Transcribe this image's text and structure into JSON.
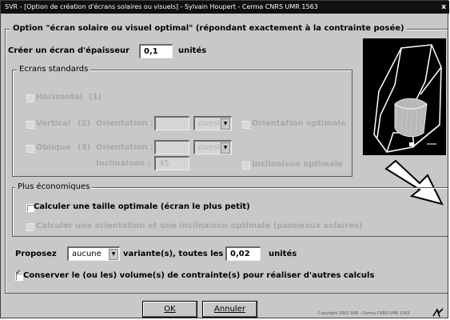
{
  "window": {
    "title": "SVR - [Option de création d'écrans solaires ou visuels] - Sylvain Houpert - Cerma CNRS UMR 1563",
    "close": "x"
  },
  "main_group": {
    "legend": "Option \"écran solaire ou visuel optimal\" (répondant exactement à la contrainte posée)"
  },
  "thickness": {
    "label": "Créer un écran d'épaisseur",
    "value": "0,1",
    "unit": "unités"
  },
  "standards": {
    "legend": "Ecrans standards",
    "horizontal": {
      "label": "Horizontal",
      "num": "(1)"
    },
    "vertical": {
      "label": "Vertical",
      "num": "(2)",
      "orient_label": "Orientation :",
      "orient_value": "",
      "direction": "ouest",
      "optimal_label": "Orientation optimale"
    },
    "oblique": {
      "label": "Oblique",
      "num": "(3)",
      "orient_label": "Orientation :",
      "orient_value": "",
      "direction": "ouest",
      "incl_label": "Inclinaison :",
      "incl_value": "45",
      "incl_optimal_label": "Inclinaison optimale"
    }
  },
  "economic": {
    "legend": "Plus économiques",
    "opt1": "Calculer une taille optimale (écran le plus petit)",
    "opt2": "Calculer une orientation et une inclinaison optimale (panneaux solaires)"
  },
  "propose": {
    "label": "Proposez",
    "select": "aucune",
    "mid": "variante(s), toutes les",
    "value": "0,02",
    "unit": "unités"
  },
  "keep": {
    "label": "Conserver le (ou les) volume(s) de contrainte(s) pour réaliser d'autres calculs"
  },
  "buttons": {
    "ok": "OK",
    "cancel": "Annuler"
  },
  "copyright": "Copyright 2001 SVR - Cerma CNRS UMR 1563"
}
